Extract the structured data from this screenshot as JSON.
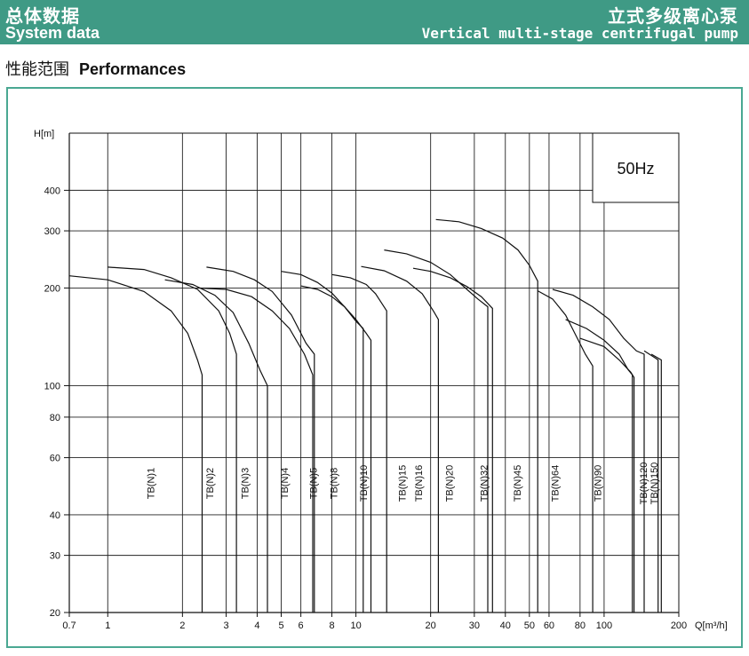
{
  "header": {
    "cn_left": "总体数据",
    "en_left": "System data",
    "cn_right": "立式多级离心泵",
    "en_right": "Vertical multi-stage centrifugal pump",
    "accent": "#3f9a85"
  },
  "section": {
    "cn": "性能范围",
    "en": "Performances"
  },
  "chart_data": {
    "type": "line",
    "xscale": "log",
    "yscale": "log",
    "xlim": [
      0.7,
      200
    ],
    "ylim": [
      20,
      600
    ],
    "xlabel": "Q[m³/h]",
    "ylabel": "H[m]",
    "frequency_label": "50Hz",
    "grid": true,
    "x_ticks": [
      0.7,
      1,
      2,
      3,
      4,
      5,
      6,
      8,
      10,
      20,
      30,
      40,
      50,
      60,
      80,
      100,
      200
    ],
    "y_ticks": [
      20,
      30,
      40,
      60,
      80,
      100,
      200,
      300,
      400
    ],
    "series": [
      {
        "name": "TB(N)1",
        "label_q": 1.5,
        "points": [
          [
            0.7,
            218
          ],
          [
            1.0,
            212
          ],
          [
            1.4,
            195
          ],
          [
            1.8,
            170
          ],
          [
            2.1,
            145
          ],
          [
            2.3,
            120
          ],
          [
            2.4,
            108
          ]
        ]
      },
      {
        "name": "TB(N)1",
        "label_q": 1.5,
        "points": [
          [
            1.0,
            232
          ],
          [
            1.4,
            228
          ],
          [
            1.8,
            215
          ],
          [
            2.3,
            198
          ],
          [
            2.8,
            170
          ],
          [
            3.1,
            145
          ],
          [
            3.3,
            125
          ]
        ]
      },
      {
        "name": "TB(N)2",
        "label_q": 2.6,
        "points": [
          [
            1.7,
            212
          ],
          [
            2.2,
            205
          ],
          [
            2.7,
            190
          ],
          [
            3.2,
            168
          ],
          [
            3.7,
            135
          ],
          [
            4.1,
            112
          ],
          [
            4.4,
            100
          ]
        ]
      },
      {
        "name": "TB(N)3",
        "label_q": 3.6,
        "points": [
          [
            2.5,
            232
          ],
          [
            3.2,
            225
          ],
          [
            3.9,
            212
          ],
          [
            4.6,
            195
          ],
          [
            5.5,
            165
          ],
          [
            6.3,
            135
          ],
          [
            6.8,
            125
          ]
        ]
      },
      {
        "name": "TB(N)3",
        "label_q": 3.6,
        "points": [
          [
            2.3,
            200
          ],
          [
            3.0,
            198
          ],
          [
            3.8,
            188
          ],
          [
            4.6,
            170
          ],
          [
            5.4,
            150
          ],
          [
            6.2,
            125
          ],
          [
            6.7,
            108
          ]
        ]
      },
      {
        "name": "TB(N)4",
        "label_q": 5.2,
        "points": [
          [
            5.0,
            225
          ],
          [
            6.0,
            220
          ],
          [
            7.0,
            208
          ],
          [
            8.0,
            193
          ],
          [
            9.0,
            175
          ],
          [
            10.0,
            158
          ],
          [
            10.7,
            150
          ]
        ]
      },
      {
        "name": "TB(N)5",
        "label_q": 6.8,
        "points": [
          [
            6.0,
            203
          ],
          [
            7.0,
            198
          ],
          [
            8.0,
            188
          ],
          [
            9.0,
            175
          ],
          [
            10.0,
            160
          ],
          [
            11.0,
            145
          ],
          [
            11.5,
            138
          ]
        ]
      },
      {
        "name": "TB(N)8",
        "label_q": 8.2,
        "points": [
          [
            8.0,
            220
          ],
          [
            9.5,
            215
          ],
          [
            11.0,
            205
          ],
          [
            12.0,
            192
          ],
          [
            12.8,
            178
          ],
          [
            13.3,
            170
          ]
        ]
      },
      {
        "name": "TB(N)10",
        "label_q": 10.8,
        "points": [
          [
            10.5,
            233
          ],
          [
            13.0,
            226
          ],
          [
            16.0,
            210
          ],
          [
            18.5,
            192
          ],
          [
            20.5,
            170
          ],
          [
            21.5,
            160
          ]
        ]
      },
      {
        "name": "TB(N)15",
        "label_q": 15.5,
        "points": [
          [
            13.0,
            262
          ],
          [
            16.0,
            255
          ],
          [
            20.0,
            240
          ],
          [
            24.0,
            220
          ],
          [
            28.0,
            198
          ],
          [
            31.0,
            185
          ],
          [
            34.0,
            175
          ]
        ]
      },
      {
        "name": "TB(N)16",
        "label_q": 18.0,
        "points": [
          [
            17.0,
            230
          ],
          [
            20.0,
            225
          ],
          [
            24.0,
            215
          ],
          [
            28.0,
            202
          ],
          [
            32.0,
            188
          ],
          [
            35.5,
            173
          ]
        ]
      },
      {
        "name": "TB(N)20",
        "label_q": 24.0,
        "points": [
          [
            21.0,
            325
          ],
          [
            26.0,
            320
          ],
          [
            32.0,
            305
          ],
          [
            39.0,
            285
          ],
          [
            45.0,
            262
          ],
          [
            50.0,
            235
          ],
          [
            54.0,
            210
          ]
        ]
      },
      {
        "name": "TB(N)32",
        "label_q": 33.0,
        "points": [
          [
            54.0,
            196
          ],
          [
            62.0,
            185
          ],
          [
            70.0,
            165
          ],
          [
            78.0,
            140
          ],
          [
            84.0,
            125
          ],
          [
            90.0,
            115
          ]
        ]
      },
      {
        "name": "TB(N)45",
        "label_q": 45.0,
        "points": [
          [
            62.0,
            198
          ],
          [
            75.0,
            190
          ],
          [
            90.0,
            175
          ],
          [
            105.0,
            160
          ],
          [
            120.0,
            140
          ],
          [
            135.0,
            128
          ],
          [
            145.0,
            125
          ]
        ]
      },
      {
        "name": "TB(N)64",
        "label_q": 64.0,
        "points": [
          [
            70.0,
            160
          ],
          [
            85.0,
            150
          ],
          [
            100.0,
            138
          ],
          [
            115.0,
            125
          ],
          [
            125.0,
            112
          ],
          [
            130.0,
            108
          ]
        ]
      },
      {
        "name": "TB(N)90",
        "label_q": 95.0,
        "points": [
          [
            80.0,
            140
          ],
          [
            100.0,
            132
          ],
          [
            115.0,
            120
          ],
          [
            128.0,
            110
          ],
          [
            132.0,
            106
          ]
        ]
      },
      {
        "name": "TB(N)120",
        "label_q": 145.0,
        "points": [
          [
            145.0,
            128
          ],
          [
            160.0,
            122
          ],
          [
            165.0,
            120
          ]
        ]
      },
      {
        "name": "TB(N)150",
        "label_q": 160.0,
        "points": [
          [
            155.0,
            125
          ],
          [
            170.0,
            120
          ]
        ]
      }
    ]
  }
}
